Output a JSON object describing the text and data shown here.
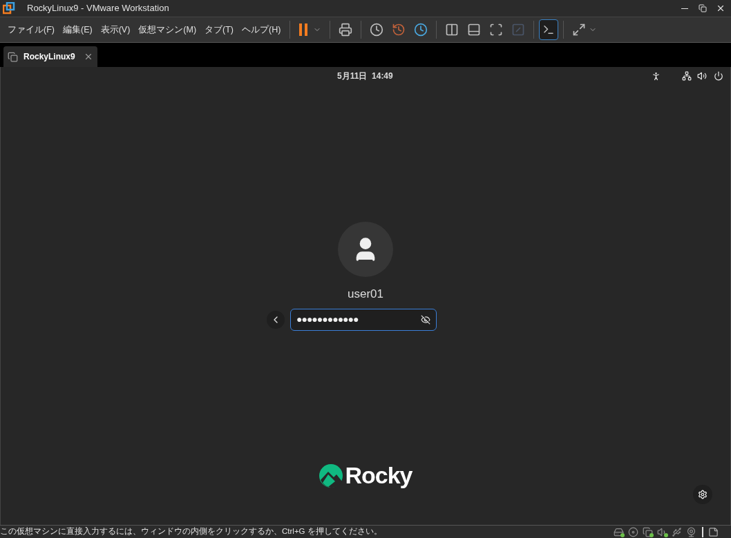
{
  "window": {
    "title": "RockyLinux9 - VMware Workstation"
  },
  "menu": [
    "ファイル(F)",
    "編集(E)",
    "表示(V)",
    "仮想マシン(M)",
    "タブ(T)",
    "ヘルプ(H)"
  ],
  "toolbar": [
    {
      "kind": "pause",
      "selected": false
    },
    {
      "kind": "send-keys",
      "selected": false
    },
    {
      "kind": "snapshot",
      "selected": false
    },
    {
      "kind": "revert",
      "selected": false
    },
    {
      "kind": "snapshot-manager",
      "selected": false
    },
    {
      "kind": "library",
      "selected": false
    },
    {
      "kind": "thumbnail",
      "selected": false
    },
    {
      "kind": "fullscreen",
      "selected": false
    },
    {
      "kind": "unity",
      "selected": false,
      "disabled": true
    },
    {
      "kind": "console",
      "selected": true
    },
    {
      "kind": "stretch",
      "selected": false
    }
  ],
  "tabs": [
    {
      "label": "RockyLinux9",
      "selected": true
    }
  ],
  "guest": {
    "clock": "5月11日  14:49",
    "user": "user01",
    "password": "●●●●●●●●●●●●",
    "logo": "Rocky"
  },
  "status_bar": {
    "message": "この仮想マシンに直接入力するには、ウィンドウの内側をクリックするか、Ctrl+G を押してください。",
    "devices": [
      {
        "kind": "disk",
        "connected": true
      },
      {
        "kind": "cd",
        "connected": false
      },
      {
        "kind": "network",
        "connected": true
      },
      {
        "kind": "sound",
        "connected": true
      },
      {
        "kind": "usb",
        "connected": false
      },
      {
        "kind": "camera",
        "connected": false
      }
    ]
  }
}
